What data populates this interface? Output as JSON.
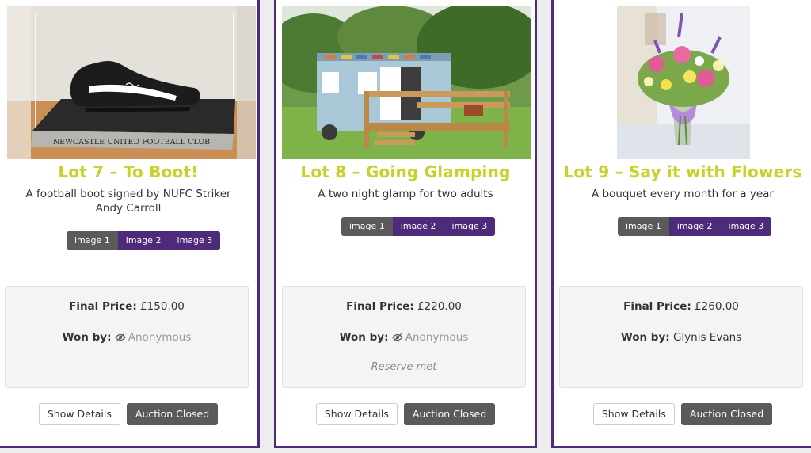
{
  "lots": [
    {
      "title": "Lot 7 – To Boot!",
      "description": "A football boot signed by NUFC Striker Andy Carroll",
      "image_caption": "NEWCASTLE UNITED FOOTBALL CLUB",
      "image_tabs": [
        "image 1",
        "image 2",
        "image 3"
      ],
      "final_price_label": "Final Price:",
      "final_price": "£150.00",
      "won_by_label": "Won by:",
      "winner": "Anonymous",
      "winner_anonymous": true,
      "reserve_note": "",
      "details_button": "Show Details",
      "status_button": "Auction Closed"
    },
    {
      "title": "Lot 8 – Going Glamping",
      "description": "A two night glamp for two adults",
      "image_tabs": [
        "image 1",
        "image 2",
        "image 3"
      ],
      "final_price_label": "Final Price:",
      "final_price": "£220.00",
      "won_by_label": "Won by:",
      "winner": "Anonymous",
      "winner_anonymous": true,
      "reserve_note": "Reserve met",
      "details_button": "Show Details",
      "status_button": "Auction Closed"
    },
    {
      "title": "Lot 9 – Say it with Flowers",
      "description": "A bouquet every month for a year",
      "image_tabs": [
        "image 1",
        "image 2",
        "image 3"
      ],
      "final_price_label": "Final Price:",
      "final_price": "£260.00",
      "won_by_label": "Won by:",
      "winner": "Glynis Evans",
      "winner_anonymous": false,
      "reserve_note": "",
      "details_button": "Show Details",
      "status_button": "Auction Closed"
    }
  ],
  "colors": {
    "title_accent": "#c6d12a",
    "card_border": "#4d2a7a",
    "tab_inactive": "#4d2a7a",
    "tab_active": "#5a5a5a",
    "closed_button": "#5a5a5a"
  },
  "icons": {
    "anonymous": "eye-icon"
  }
}
